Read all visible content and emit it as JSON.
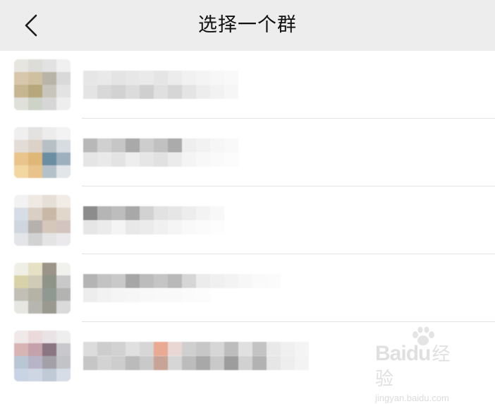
{
  "navbar": {
    "title": "选择一个群",
    "back_icon": "chevron-left-icon"
  },
  "groups": [
    {
      "avatar": [
        "#e7e5e0",
        "#dcdcd8",
        "#e2e2e2",
        "#f0f0f0",
        "#d8c7ad",
        "#cfc1a0",
        "#b9b4a8",
        "#d9d9d9",
        "#c7b691",
        "#b7a77d",
        "#c8c6bc",
        "#e3e3e3",
        "#dfe0d9",
        "#cdd3c6",
        "#d6d6d6",
        "#eeeeee"
      ],
      "line1": [
        "#e6e6e6",
        "#e9e9e9",
        "#e4e4e4",
        "#e7e7e7",
        "#eaeaea",
        "#e5e5e5",
        "#ececec",
        "#f1f1f1",
        "#f4f4f4",
        "#f7f7f7",
        "#f9f9f9"
      ],
      "line2": [
        "#e4e4e4",
        "#d8d8d8",
        "#d2d2d2",
        "#dcdcdc",
        "#cfcfcf",
        "#e0e0e0",
        "#d6d6d6",
        "#e4e4e4",
        "#ededed",
        "#f2f2f2",
        "#f6f6f6"
      ]
    },
    {
      "avatar": [
        "#f0efef",
        "#e4e2e0",
        "#ececec",
        "#f3f3f3",
        "#e3dcd6",
        "#ddd2c8",
        "#b7c0c5",
        "#d7dce0",
        "#eac58b",
        "#dfb878",
        "#6c8ea3",
        "#9db0bd",
        "#f3d7a3",
        "#e8c48c",
        "#b4c1c9",
        "#e2e6e9"
      ],
      "line1": [
        "#b8b8b8",
        "#d0d0d0",
        "#c6c6c6",
        "#a9a9a9",
        "#cdcdcd",
        "#c1c1c1",
        "#ababab",
        "#eeeeee",
        "#f2f2f2",
        "#f6f6f6",
        "#f9f9f9"
      ],
      "line2": [
        "#e5e5e5",
        "#e9e9e9",
        "#e3e3e3",
        "#eeeeee",
        "#e6e6e6",
        "#e1e1e1",
        "#ebebeb",
        "#f4f4f4",
        "#f8f8f8",
        "#fafafa",
        "#fcfcfc"
      ]
    },
    {
      "avatar": [
        "#f2f2f2",
        "#efe9e3",
        "#e6dfd8",
        "#f1ece6",
        "#d6dde6",
        "#d9cfc4",
        "#c9b8a5",
        "#e1d7cb",
        "#cfd6de",
        "#b6b1ac",
        "#d5c8bb",
        "#d3c4c0",
        "#e3e5e8",
        "#d2d2d2",
        "#e4e4e4",
        "#ebe9ec"
      ],
      "line1": [
        "#8c8c8c",
        "#b5b5b5",
        "#bdbdbd",
        "#a8a8a8",
        "#d2d2d2",
        "#e2e2e2",
        "#e6e6e6",
        "#ededed",
        "#f3f3f3",
        "#f8f8f8"
      ],
      "line2": [
        "#e6e6e6",
        "#ebebeb",
        "#f4f4f4",
        "#e8e8e8",
        "#ebebeb",
        "#f0f0f0",
        "#f5f5f5",
        "#f9f9f9",
        "#fbfbfb",
        "#fdfdfd"
      ]
    },
    {
      "avatar": [
        "#f0efe6",
        "#e6e1c4",
        "#9a9588",
        "#f1f1ee",
        "#d8d2a8",
        "#cfcbb7",
        "#8e9487",
        "#c9c9c9",
        "#c1bfb6",
        "#b5b2a6",
        "#8f9992",
        "#b3b3b1",
        "#e6e6e3",
        "#b7b6b0",
        "#9a9a90",
        "#dadada"
      ],
      "line1": [
        "#b4b4b4",
        "#c3c3c3",
        "#c9c9c9",
        "#a6a6a6",
        "#bcbcbc",
        "#c5c5c5",
        "#b9b9b9",
        "#d6d6d6",
        "#ececec",
        "#f0f0f0",
        "#f3f3f3",
        "#f7f7f7",
        "#fafafa",
        "#fbfbfb"
      ],
      "line2": [
        "#ededed",
        "#f2f2f2",
        "#f5f5f5",
        "#f6f6f6",
        "#f8f8f8",
        "#f9f9f9",
        "#f9f9f9",
        "#fbfbfb",
        "#fcfcfc"
      ]
    },
    {
      "avatar": [
        "#f1e9e9",
        "#eadadb",
        "#e9e3e6",
        "#eeeeee",
        "#d9b4b4",
        "#c4a1ab",
        "#8a7582",
        "#c9c8cc",
        "#b9c6d4",
        "#b7b4c8",
        "#a4a0a8",
        "#c1c3c6",
        "#c8d4e3",
        "#ced6e4",
        "#bfcad6",
        "#d6dde6"
      ],
      "line1": [
        "#dcdcdc",
        "#cdcdcd",
        "#d2d2d2",
        "#e0e0e0",
        "#d6d6d6",
        "#eaa992",
        "#e9d7d4",
        "#cfcfcf",
        "#c7c7c7",
        "#d6d6d6",
        "#bdbdbd",
        "#e0e0e0",
        "#c3c3c3",
        "#e9e9e9",
        "#f0f0f0",
        "#f4f4f4"
      ],
      "line2": [
        "#c6c6c6",
        "#d3d3d3",
        "#cdcdcd",
        "#bbbbbb",
        "#c9c9c9",
        "#c8a497",
        "#d6d6d6",
        "#bcbcbc",
        "#a8a8a8",
        "#c9c9c9",
        "#9d9d9d",
        "#d1d1d1",
        "#b2b2b2",
        "#e6e6e6",
        "#eeeeee",
        "#f3f3f3"
      ]
    }
  ],
  "watermark": {
    "brand": "Bai",
    "brand_suffix": "du",
    "brand_cn": "经验",
    "url": "jingyan.baidu.com"
  }
}
